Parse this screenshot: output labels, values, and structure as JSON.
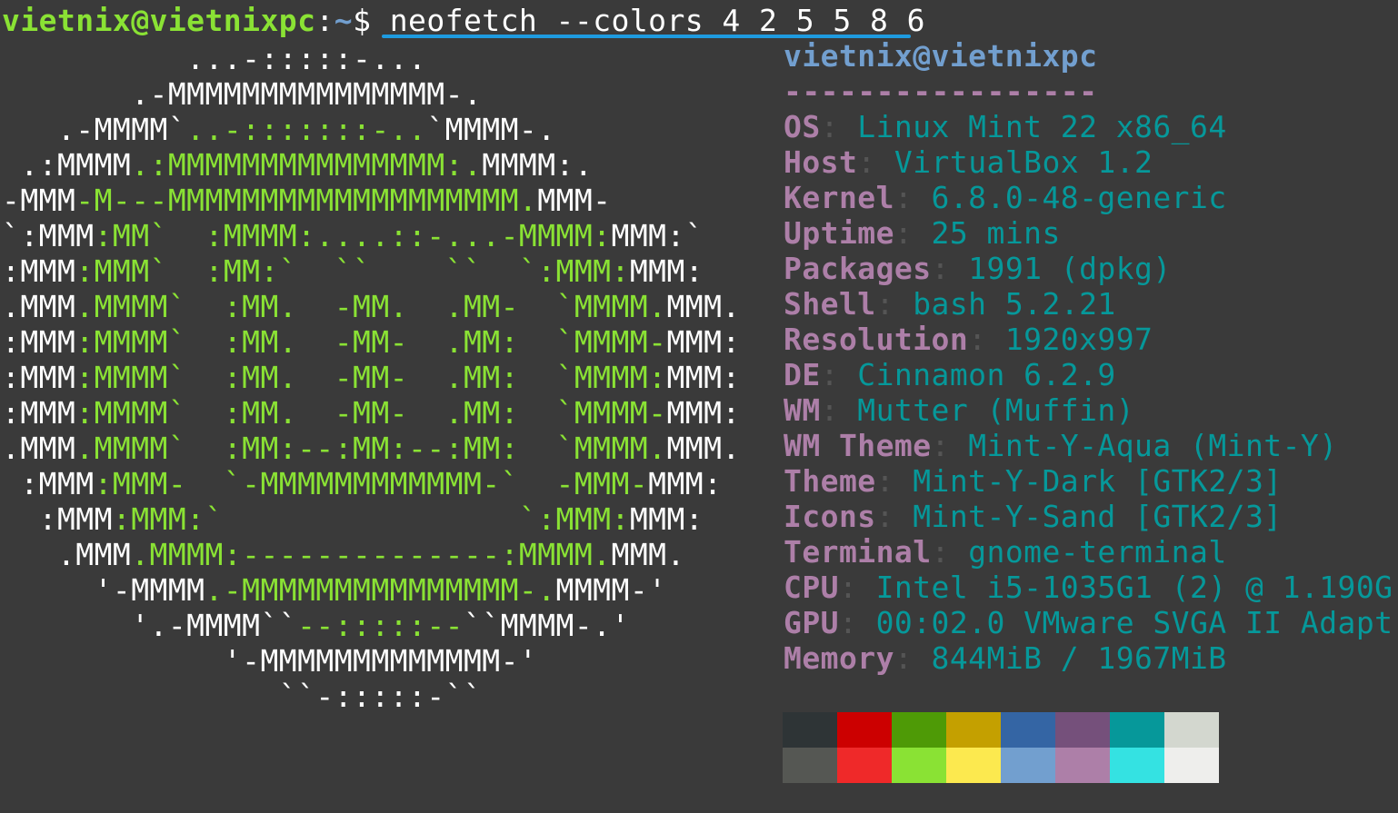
{
  "prompt": {
    "user_host": "vietnix@vietnixpc",
    "separator": ":",
    "path": "~",
    "symbol": "$ ",
    "command": "neofetch --colors 4 2 5 5 8 6"
  },
  "ascii_logo": [
    [
      [
        "w",
        "          ...-:::::-..."
      ]
    ],
    [
      [
        "w",
        "       .-MMMMMMMMMMMMMMM-."
      ]
    ],
    [
      [
        "w",
        "   .-MMMM`"
      ],
      [
        "g",
        "..-:::::::-.."
      ],
      [
        "w",
        "`MMMM-."
      ]
    ],
    [
      [
        "w",
        " .:MMMM"
      ],
      [
        "g",
        ".:MMMMMMMMMMMMMMM:."
      ],
      [
        "w",
        "MMMM:."
      ]
    ],
    [
      [
        "w",
        "-MMM"
      ],
      [
        "g",
        "-M---MMMMMMMMMMMMMMMMMMM."
      ],
      [
        "w",
        "MMM-"
      ]
    ]
  ],
  "ascii_logo_rest": [
    [
      [
        "w",
        "`:MMM"
      ],
      [
        "g",
        ":MM`  :MMMM:....::-...-MMMM:"
      ],
      [
        "w",
        "MMM:`"
      ]
    ],
    [
      [
        "w",
        ":MMM"
      ],
      [
        "g",
        ":MMM`  :MM:`  ``    ``  `:MMM:"
      ],
      [
        "w",
        "MMM:"
      ]
    ],
    [
      [
        "w",
        ".MMM"
      ],
      [
        "g",
        ".MMMM`  :MM.  -MM.  .MM-  `MMMM."
      ],
      [
        "w",
        "MMM."
      ]
    ],
    [
      [
        "w",
        ":MMM"
      ],
      [
        "g",
        ":MMMM`  :MM.  -MM-  .MM:  `MMMM-"
      ],
      [
        "w",
        "MMM:"
      ]
    ],
    [
      [
        "w",
        ":MMM"
      ],
      [
        "g",
        ":MMMM`  :MM.  -MM-  .MM:  `MMMM:"
      ],
      [
        "w",
        "MMM:"
      ]
    ],
    [
      [
        "w",
        ":MMM"
      ],
      [
        "g",
        ":MMMM`  :MM.  -MM-  .MM:  `MMMM-"
      ],
      [
        "w",
        "MMM:"
      ]
    ],
    [
      [
        "w",
        ".MMM"
      ],
      [
        "g",
        ".MMMM`  :MM:--:MM:--:MM:  `MMMM."
      ],
      [
        "w",
        "MMM."
      ]
    ],
    [
      [
        "w",
        " :MMM"
      ],
      [
        "g",
        ":MMM-  `-MMMMMMMMMMMM-`  -MMM-"
      ],
      [
        "w",
        "MMM:"
      ]
    ],
    [
      [
        "w",
        "  :MMM"
      ],
      [
        "g",
        ":MMM:`                `:MMM:"
      ],
      [
        "w",
        "MMM:"
      ]
    ],
    [
      [
        "w",
        "   .MMM"
      ],
      [
        "g",
        ".MMMM:--------------:MMMM."
      ],
      [
        "w",
        "MMM."
      ]
    ],
    [
      [
        "w",
        "     '-MMMM"
      ],
      [
        "g",
        ".-MMMMMMMMMMMMMMM-."
      ],
      [
        "w",
        "MMMM-'"
      ]
    ],
    [
      [
        "w",
        "       '.-MMMM``"
      ],
      [
        "g",
        "--:::::--"
      ],
      [
        "w",
        "``MMMM-.'"
      ]
    ],
    [
      [
        "w",
        "            '-MMMMMMMMMMMMM-'"
      ]
    ],
    [
      [
        "w",
        "               ``-:::::-``"
      ]
    ]
  ],
  "info": {
    "header": "vietnix@vietnixpc",
    "underline": "-----------------",
    "rows": [
      {
        "key": "OS",
        "value": "Linux Mint 22 x86_64"
      },
      {
        "key": "Host",
        "value": "VirtualBox 1.2"
      },
      {
        "key": "Kernel",
        "value": "6.8.0-48-generic"
      },
      {
        "key": "Uptime",
        "value": "25 mins"
      },
      {
        "key": "Packages",
        "value": "1991 (dpkg)"
      },
      {
        "key": "Shell",
        "value": "bash 5.2.21"
      },
      {
        "key": "Resolution",
        "value": "1920x997"
      },
      {
        "key": "DE",
        "value": "Cinnamon 6.2.9"
      },
      {
        "key": "WM",
        "value": "Mutter (Muffin)"
      },
      {
        "key": "WM Theme",
        "value": "Mint-Y-Aqua (Mint-Y)"
      },
      {
        "key": "Theme",
        "value": "Mint-Y-Dark [GTK2/3]"
      },
      {
        "key": "Icons",
        "value": "Mint-Y-Sand [GTK2/3]"
      },
      {
        "key": "Terminal",
        "value": "gnome-terminal"
      },
      {
        "key": "CPU",
        "value": "Intel i5-1035G1 (2) @ 1.190G"
      },
      {
        "key": "GPU",
        "value": "00:02.0 VMware SVGA II Adapt"
      },
      {
        "key": "Memory",
        "value": "844MiB / 1967MiB"
      }
    ]
  },
  "palette": {
    "normal": [
      "#2e3436",
      "#cc0000",
      "#4e9a06",
      "#c4a000",
      "#3465a4",
      "#75507b",
      "#06989a",
      "#d3d7cf"
    ],
    "bright": [
      "#555753",
      "#ef2929",
      "#8ae234",
      "#fce94f",
      "#729fcf",
      "#ad7fa8",
      "#34e2e2",
      "#eeeeec"
    ]
  }
}
